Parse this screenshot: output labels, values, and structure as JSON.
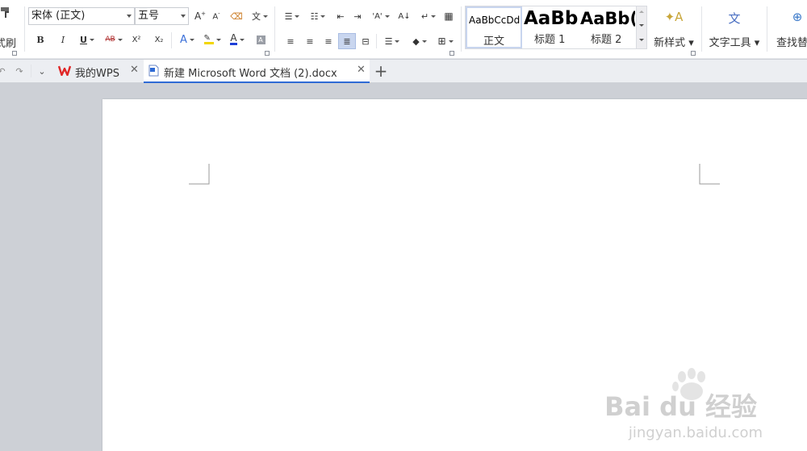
{
  "ribbon": {
    "format_painter_label": "式刷",
    "font_name": "宋体 (正文)",
    "font_size": "五号",
    "bold": "B",
    "italic": "I",
    "underline": "U",
    "strikethrough": "AB",
    "superscript": "X²",
    "subscript": "X₂",
    "text_effect": "A",
    "font_color": "A",
    "sort": "A↓",
    "styles": [
      {
        "sample": "AaBbCcDd",
        "name": "正文"
      },
      {
        "sample": "AaBb",
        "name": "标题 1"
      },
      {
        "sample": "AaBb(",
        "name": "标题 2"
      }
    ],
    "new_style_label": "新样式",
    "text_tools_label": "文字工具",
    "find_replace_label": "查找替"
  },
  "tabs": [
    {
      "label": "我的WPS"
    },
    {
      "label": "新建 Microsoft Word 文档 (2).docx"
    }
  ],
  "watermark": {
    "line1": "Bai du 经验",
    "line2": "jingyan.baidu.com"
  },
  "colors": {
    "accent": "#2f6bd5",
    "wps_red": "#e02727",
    "font_color_bar": "#1e3fd8",
    "highlight_bar": "#f2d600",
    "workspace": "#cdd0d6"
  }
}
